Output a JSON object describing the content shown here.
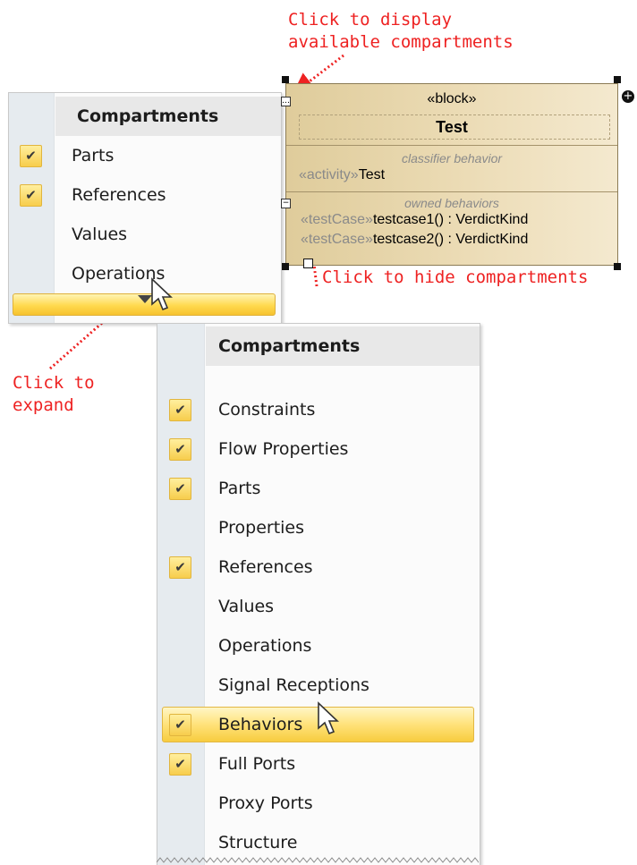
{
  "annotations": {
    "display_line1": "Click to display",
    "display_line2": "available compartments",
    "hide": "Click to hide compartments",
    "expand_line1": "Click to",
    "expand_line2": "expand"
  },
  "menu_small": {
    "header": "Compartments",
    "items": [
      {
        "label": "Parts",
        "checked": true
      },
      {
        "label": "References",
        "checked": true
      },
      {
        "label": "Values",
        "checked": false
      },
      {
        "label": "Operations",
        "checked": false
      }
    ]
  },
  "menu_large": {
    "header": "Compartments",
    "items": [
      {
        "label": "Constraints",
        "checked": true
      },
      {
        "label": "Flow Properties",
        "checked": true
      },
      {
        "label": "Parts",
        "checked": true
      },
      {
        "label": "Properties",
        "checked": false
      },
      {
        "label": "References",
        "checked": true
      },
      {
        "label": "Values",
        "checked": false
      },
      {
        "label": "Operations",
        "checked": false
      },
      {
        "label": "Signal Receptions",
        "checked": false
      },
      {
        "label": "Behaviors",
        "checked": true,
        "highlighted": true
      },
      {
        "label": "Full Ports",
        "checked": true
      },
      {
        "label": "Proxy Ports",
        "checked": false
      },
      {
        "label": "Structure",
        "checked": false
      }
    ]
  },
  "block": {
    "stereotype": "«block»",
    "name": "Test",
    "classifier_caption": "classifier behavior",
    "classifier_stereotype": "«activity»",
    "classifier_value": "Test",
    "owned_caption": "owned behaviors",
    "owned": [
      {
        "stereotype": "«testCase»",
        "name": "testcase1",
        "sig": "() : VerdictKind"
      },
      {
        "stereotype": "«testCase»",
        "name": "testcase2",
        "sig": "() : VerdictKind"
      }
    ]
  },
  "icons": {
    "check": "✔",
    "collapse": "−",
    "dots": "…",
    "expand_triangle": "▼",
    "add": "+"
  },
  "colors": {
    "annotation": "#ee2222",
    "highlight": "#ffe27a",
    "check_fill": "#f7cd4c",
    "block_fill": "#ecdcb6"
  }
}
